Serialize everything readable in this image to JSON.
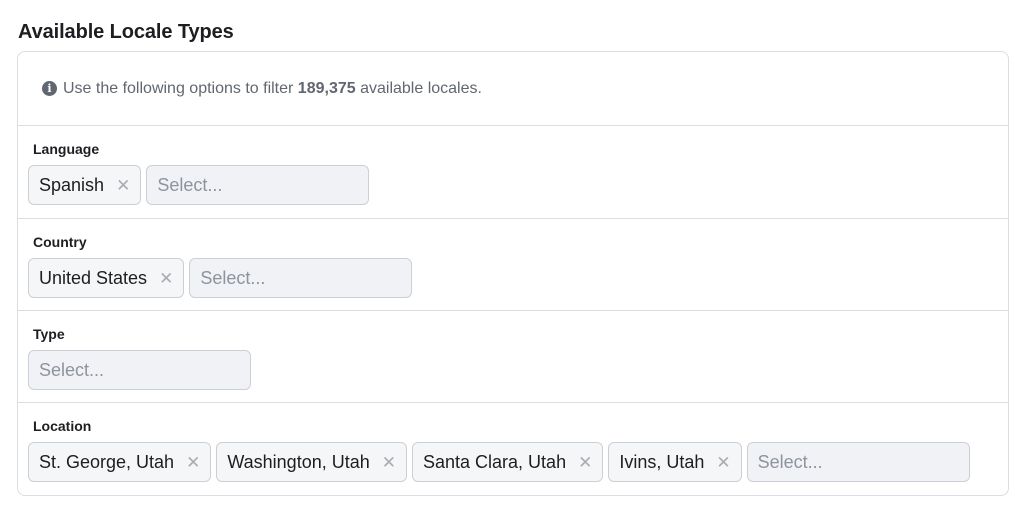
{
  "header": {
    "title": "Available Locale Types"
  },
  "info": {
    "prefix": "Use the following options to filter",
    "count": "189,375",
    "suffix": "available locales."
  },
  "filters": {
    "language": {
      "label": "Language",
      "tokens": [
        "Spanish"
      ],
      "placeholder": "Select..."
    },
    "country": {
      "label": "Country",
      "tokens": [
        "United States"
      ],
      "placeholder": "Select..."
    },
    "type": {
      "label": "Type",
      "tokens": [],
      "placeholder": "Select..."
    },
    "location": {
      "label": "Location",
      "tokens": [
        "St. George, Utah",
        "Washington, Utah",
        "Santa Clara, Utah",
        "Ivins, Utah"
      ],
      "placeholder": "Select..."
    }
  },
  "icons": {
    "info": "info-icon",
    "remove": "close-icon"
  },
  "colors": {
    "border": "#dadde1",
    "token_bg": "#f5f6f7",
    "input_bg": "#f0f2f5",
    "muted_text": "#606770",
    "placeholder": "#8d949e"
  }
}
